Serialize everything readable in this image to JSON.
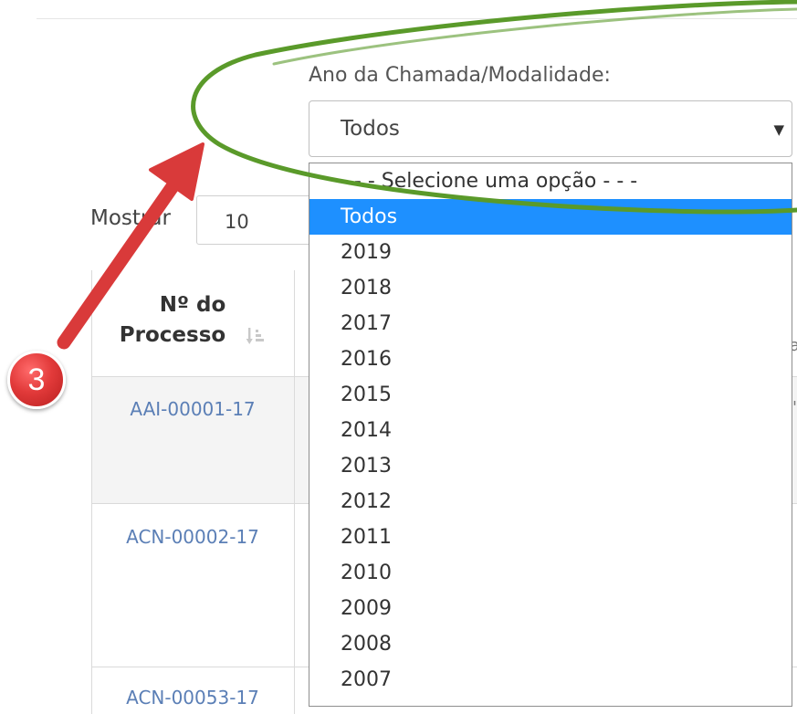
{
  "filter": {
    "label": "Ano da Chamada/Modalidade:",
    "selected": "Todos",
    "caret": "▼",
    "options": [
      "- - - Selecione uma opção - - -",
      "Todos",
      "2019",
      "2018",
      "2017",
      "2016",
      "2015",
      "2014",
      "2013",
      "2012",
      "2011",
      "2010",
      "2009",
      "2008",
      "2007"
    ],
    "highlighted_index": 1
  },
  "length_control": {
    "label": "Mostrar",
    "value": "10"
  },
  "table": {
    "header_line1": "Nº do",
    "header_line2": "Processo",
    "rows": [
      "AAI-00001-17",
      "ACN-00002-17",
      "ACN-00053-17"
    ]
  },
  "annotation": {
    "step_number": "3",
    "ellipse_color": "#5a9a2a",
    "arrow_color": "#d93a3a",
    "badge_color": "#e23a3a"
  },
  "colors": {
    "highlight": "#1e90ff",
    "link": "#5b7fb6"
  }
}
